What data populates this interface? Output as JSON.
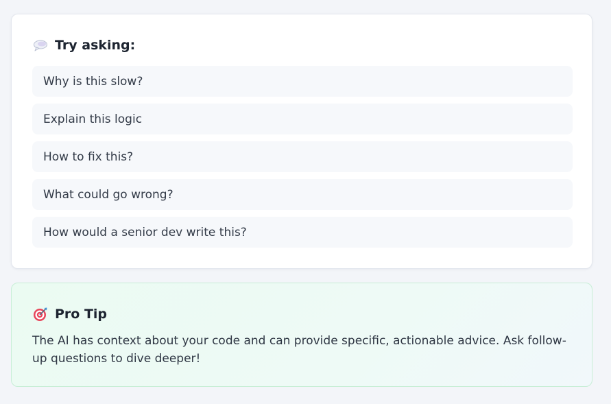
{
  "suggestions": {
    "heading_icon": "speech-bubble-icon",
    "title": "Try asking:",
    "items": [
      {
        "label": "Why is this slow?"
      },
      {
        "label": "Explain this logic"
      },
      {
        "label": "How to fix this?"
      },
      {
        "label": "What could go wrong?"
      },
      {
        "label": "How would a senior dev write this?"
      }
    ]
  },
  "tip": {
    "heading_icon": "target-icon",
    "title": "Pro Tip",
    "text": "The AI has context about your code and can provide specific, actionable advice. Ask follow-up questions to dive deeper!"
  },
  "colors": {
    "page_background": "#f3f5f9",
    "card_background": "#ffffff",
    "suggestion_background": "#f6f8fb",
    "tip_background": "#ebfbf2",
    "tip_border": "#c7eed6",
    "target_red": "#e8455a"
  }
}
